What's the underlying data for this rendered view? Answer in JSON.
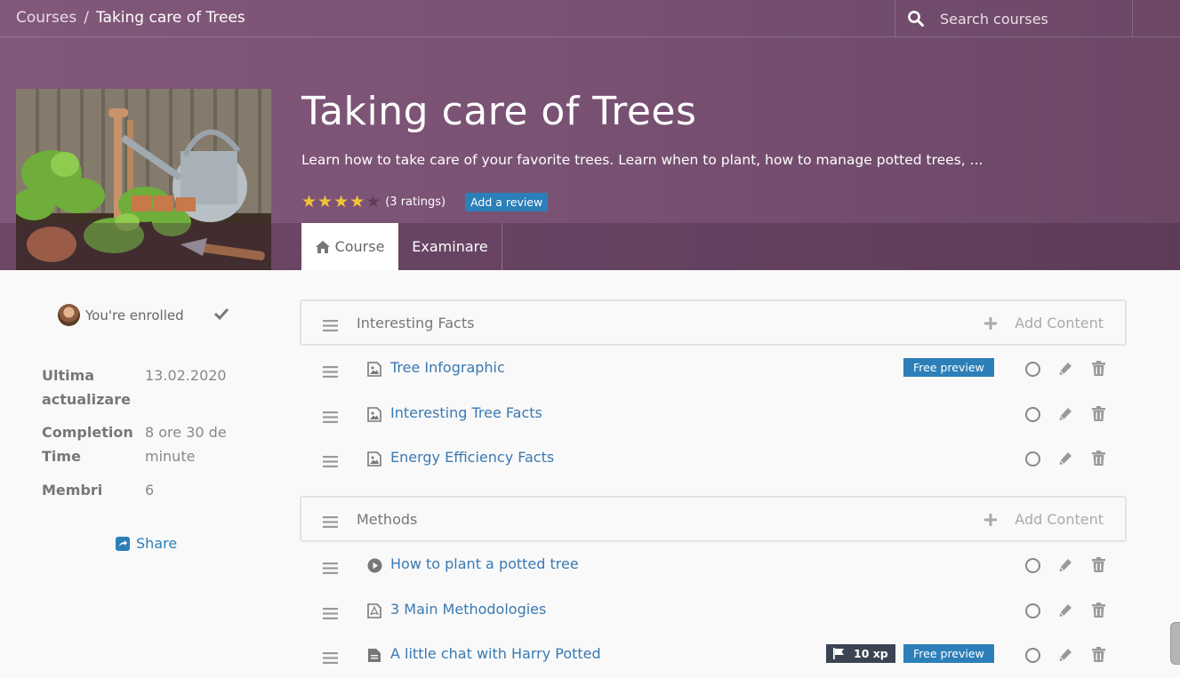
{
  "breadcrumb": {
    "root": "Courses",
    "separator": "/",
    "current": "Taking care of Trees"
  },
  "search": {
    "placeholder": "Search courses"
  },
  "course": {
    "title": "Taking care of Trees",
    "description": "Learn how to take care of your favorite trees. Learn when to plant, how to manage potted trees, ...",
    "rating": {
      "stars": 4,
      "max": 5,
      "text": "(3 ratings)"
    },
    "review_button": "Add a review"
  },
  "tabs": [
    {
      "label": "Course",
      "icon": "home-icon",
      "active": true
    },
    {
      "label": "Examinare",
      "active": false
    }
  ],
  "sidebar": {
    "enrolled_text": "You're enrolled",
    "info": [
      {
        "key": "Ultima actualizare",
        "value": "13.02.2020"
      },
      {
        "key": "Completion Time",
        "value": "8 ore 30 de minute"
      },
      {
        "key": "Membri",
        "value": "6"
      }
    ],
    "share_label": "Share"
  },
  "add_content_label": "Add Content",
  "sections": [
    {
      "name": "Interesting Facts",
      "items": [
        {
          "name": "Tree Infographic",
          "icon": "image-icon",
          "free_preview": true
        },
        {
          "name": "Interesting Tree Facts",
          "icon": "image-icon",
          "free_preview": false
        },
        {
          "name": "Energy Efficiency Facts",
          "icon": "image-icon",
          "free_preview": false
        }
      ]
    },
    {
      "name": "Methods",
      "items": [
        {
          "name": "How to plant a potted tree",
          "icon": "play-circle-icon",
          "free_preview": false
        },
        {
          "name": "3 Main Methodologies",
          "icon": "pdf-file-icon",
          "free_preview": false
        },
        {
          "name": "A little chat with Harry Potted",
          "icon": "document-icon",
          "free_preview": true,
          "xp": "10 xp"
        }
      ]
    }
  ],
  "badges": {
    "free_preview": "Free preview"
  },
  "colors": {
    "header": "#7a5274",
    "accent": "#2c7fb8",
    "link": "#3a79b2",
    "star": "#f3c13a"
  }
}
